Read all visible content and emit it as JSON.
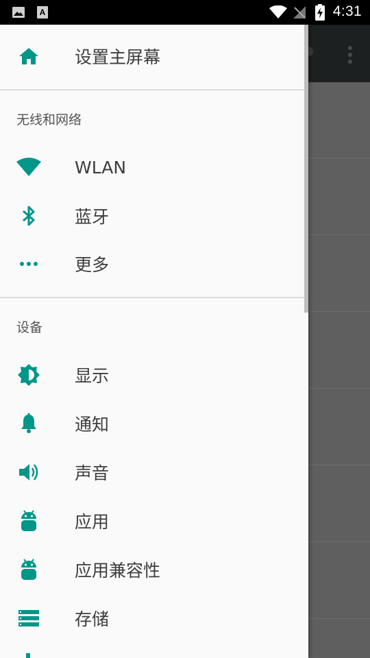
{
  "status_bar": {
    "time": "4:31",
    "icons": [
      "image-notification-icon",
      "text-notification-icon",
      "wifi-icon",
      "no-signal-icon",
      "battery-charging-icon"
    ]
  },
  "drawer": {
    "home": {
      "label": "设置主屏幕",
      "icon": "home-icon"
    },
    "sections": [
      {
        "header": "无线和网络",
        "items": [
          {
            "label": "WLAN",
            "icon": "wifi-icon"
          },
          {
            "label": "蓝牙",
            "icon": "bluetooth-icon"
          },
          {
            "label": "更多",
            "icon": "more-horiz-icon"
          }
        ]
      },
      {
        "header": "设备",
        "items": [
          {
            "label": "显示",
            "icon": "brightness-icon"
          },
          {
            "label": "通知",
            "icon": "bell-icon"
          },
          {
            "label": "声音",
            "icon": "volume-icon"
          },
          {
            "label": "应用",
            "icon": "android-icon"
          },
          {
            "label": "应用兼容性",
            "icon": "android-icon"
          },
          {
            "label": "存储",
            "icon": "storage-icon"
          }
        ]
      }
    ]
  },
  "colors": {
    "accent": "#009688",
    "drawer_bg": "#fafafa",
    "scrim": "#5f5f5f",
    "text": "#3d3d3d"
  }
}
